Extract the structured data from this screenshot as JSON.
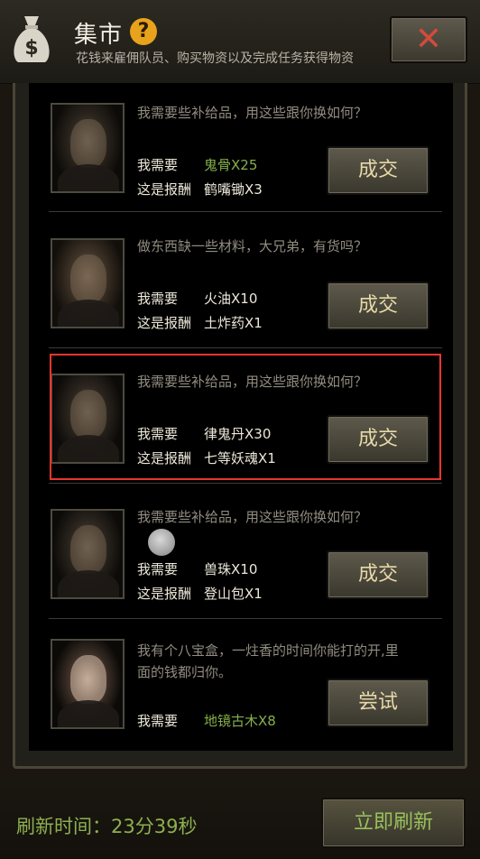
{
  "header": {
    "title": "集市",
    "help_glyph": "?",
    "subtitle": "花钱来雇佣队员、购买物资以及完成任务获得物资",
    "close_glyph": "✕",
    "icons": {
      "bag": "money-bag-icon",
      "help": "help-icon",
      "close": "close-icon"
    }
  },
  "labels": {
    "need": "我需要",
    "reward": "这是报酬"
  },
  "trades": [
    {
      "request": "我需要些补给品，用这些跟你换如何？",
      "need": "鬼骨X25",
      "need_highlight": true,
      "reward": "鹤嘴锄X3",
      "button": "成交"
    },
    {
      "request": "做东西缺一些材料，大兄弟，有货吗？",
      "need": "火油X10",
      "need_highlight": false,
      "reward": "土炸药X1",
      "button": "成交"
    },
    {
      "request": "我需要些补给品，用这些跟你换如何？",
      "need": "律鬼丹X30",
      "need_highlight": false,
      "reward": "七等妖魂X1",
      "button": "成交"
    },
    {
      "request": "我需要些补给品，用这些跟你换如何？",
      "need": "兽珠X10",
      "need_highlight": false,
      "reward": "登山包X1",
      "button": "成交"
    },
    {
      "request_line1": "我有个八宝盒，一炷香的时间你能打的开,里",
      "request_line2": "面的钱都归你。",
      "need": "地镜古木X8",
      "need_highlight": true,
      "button": "尝试"
    }
  ],
  "footer": {
    "refresh_time": "刷新时间：23分39秒",
    "refresh_button": "立即刷新"
  },
  "colors": {
    "accent_green": "#86b04a",
    "highlight_red": "#e8362f",
    "close_red": "#d24b3b"
  }
}
